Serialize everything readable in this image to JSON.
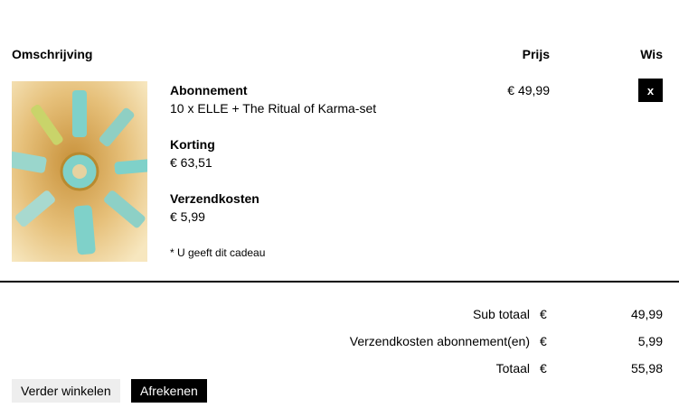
{
  "table": {
    "headers": {
      "description": "Omschrijving",
      "price": "Prijs",
      "delete": "Wis"
    }
  },
  "item": {
    "image_alt": "Ritual of Karma producten",
    "subscription_label": "Abonnement",
    "subscription_desc": "10 x ELLE + The Ritual of Karma-set",
    "discount_label": "Korting",
    "discount_value": "€ 63,51",
    "shipping_label": "Verzendkosten",
    "shipping_value": "€ 5,99",
    "gift_note": "* U geeft dit cadeau",
    "price": "€ 49,99",
    "delete_label": "x"
  },
  "summary": {
    "rows": [
      {
        "label": "Sub totaal",
        "currency": "€",
        "value": "49,99"
      },
      {
        "label": "Verzendkosten abonnement(en)",
        "currency": "€",
        "value": "5,99"
      },
      {
        "label": "Totaal",
        "currency": "€",
        "value": "55,98"
      }
    ]
  },
  "actions": {
    "continue_label": "Verder winkelen",
    "checkout_label": "Afrekenen"
  },
  "colors": {
    "accent": "#000000",
    "secondary_button": "#eeeeee",
    "image_bg": "#e9c889"
  }
}
